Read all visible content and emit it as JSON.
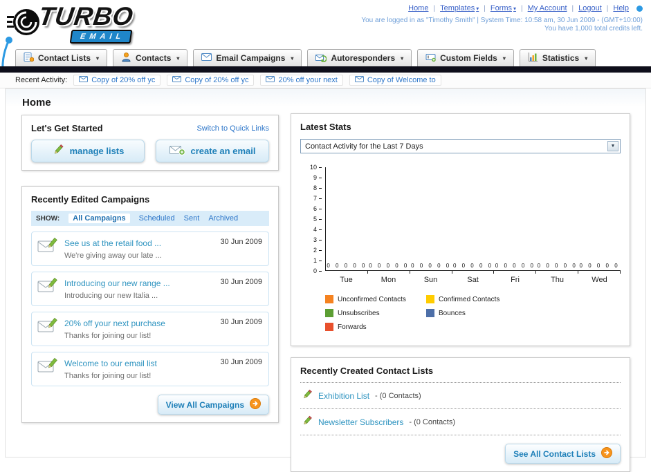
{
  "icons": {
    "caret": "▾",
    "select_arrow": "▼"
  },
  "header": {
    "logo_line1": "TURBO",
    "logo_line2": "EMAIL",
    "links": [
      {
        "label": "Home"
      },
      {
        "label": "Templates"
      },
      {
        "label": "Forms"
      },
      {
        "label": "My Account"
      },
      {
        "label": "Logout"
      },
      {
        "label": "Help"
      }
    ],
    "login_info": "You are logged in as \"Timothy Smith\" | System Time: 10:58 am, 30 Jun 2009 - (GMT+10:00)",
    "credits_info": "You have 1,000 total credits left."
  },
  "nav": {
    "items": [
      {
        "label": "Contact Lists"
      },
      {
        "label": "Contacts"
      },
      {
        "label": "Email Campaigns"
      },
      {
        "label": "Autoresponders"
      },
      {
        "label": "Custom Fields"
      },
      {
        "label": "Statistics"
      }
    ]
  },
  "recent_activity": {
    "label": "Recent Activity:",
    "items": [
      "Copy of 20% off yc",
      "Copy of 20% off yc",
      "20% off your next",
      "Copy of Welcome to"
    ]
  },
  "page_title": "Home",
  "get_started": {
    "title": "Let's Get Started",
    "switch_link": "Switch to Quick Links",
    "buttons": [
      "manage lists",
      "create an email"
    ]
  },
  "campaigns": {
    "title": "Recently Edited Campaigns",
    "show_label": "SHOW:",
    "tabs": [
      "All Campaigns",
      "Scheduled",
      "Sent",
      "Archived"
    ],
    "items": [
      {
        "title": "See us at the retail food ...",
        "subtitle": "We're giving away our late ...",
        "date": "30 Jun 2009"
      },
      {
        "title": "Introducing our new range ...",
        "subtitle": "Introducing our new Italia ...",
        "date": "30 Jun 2009"
      },
      {
        "title": "20% off your next purchase",
        "subtitle": "Thanks for joining our list!",
        "date": "30 Jun 2009"
      },
      {
        "title": "Welcome to our email list",
        "subtitle": "Thanks for joining our list!",
        "date": "30 Jun 2009"
      }
    ],
    "view_all": "View All Campaigns"
  },
  "stats": {
    "title": "Latest Stats",
    "period_selector_value": "Contact Activity for the Last 7 Days",
    "chart_data": {
      "type": "bar",
      "title": "Contact Activity for the Last 7 Days",
      "categories": [
        "Tue",
        "Mon",
        "Sun",
        "Sat",
        "Fri",
        "Thu",
        "Wed"
      ],
      "series": [
        {
          "name": "Unconfirmed Contacts",
          "color": "#f58220",
          "values": [
            0,
            0,
            0,
            0,
            0,
            0,
            0
          ]
        },
        {
          "name": "Confirmed Contacts",
          "color": "#ffcc00",
          "values": [
            0,
            0,
            0,
            0,
            0,
            0,
            0
          ]
        },
        {
          "name": "Unsubscribes",
          "color": "#5c9e33",
          "values": [
            0,
            0,
            0,
            0,
            0,
            0,
            0
          ]
        },
        {
          "name": "Bounces",
          "color": "#4d6fa8",
          "values": [
            0,
            0,
            0,
            0,
            0,
            0,
            0
          ]
        },
        {
          "name": "Forwards",
          "color": "#e8502d",
          "values": [
            0,
            0,
            0,
            0,
            0,
            0,
            0
          ]
        }
      ],
      "ylim": [
        0,
        10
      ],
      "yticks": [
        10,
        9,
        8,
        7,
        6,
        5,
        4,
        3,
        2,
        1,
        0
      ],
      "grid": false,
      "legend_position": "bottom"
    }
  },
  "contact_lists": {
    "title": "Recently Created Contact Lists",
    "items": [
      {
        "name": "Exhibition List",
        "detail": "- (0 Contacts)"
      },
      {
        "name": "Newsletter Subscribers",
        "detail": "- (0 Contacts)"
      }
    ],
    "see_all": "See All Contact Lists"
  }
}
